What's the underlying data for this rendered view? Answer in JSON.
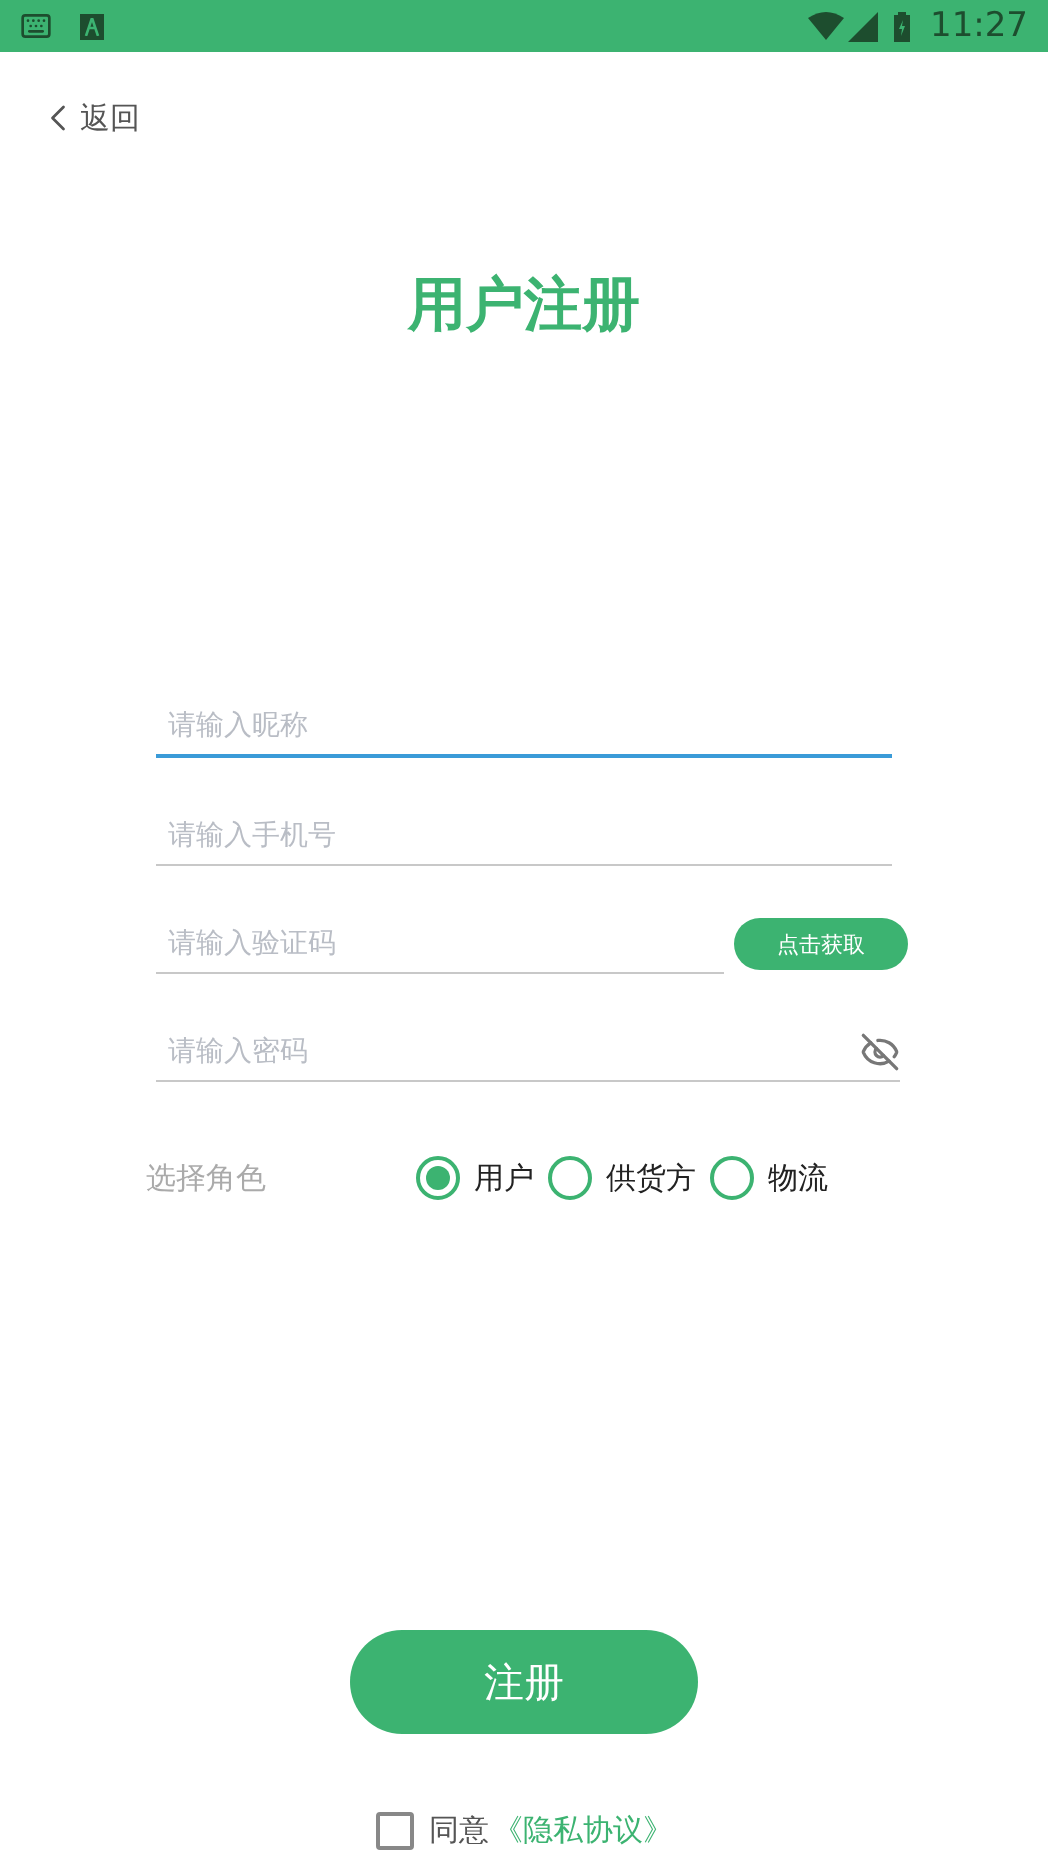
{
  "status_bar": {
    "time": "11:27"
  },
  "back": {
    "label": "返回"
  },
  "title": "用户注册",
  "fields": [
    {
      "kind": "text",
      "placeholder": "请输入昵称",
      "focused": true
    },
    {
      "kind": "text",
      "placeholder": "请输入手机号",
      "focused": false
    },
    {
      "kind": "code",
      "placeholder": "请输入验证码",
      "focused": false,
      "button": "点击获取"
    },
    {
      "kind": "password",
      "placeholder": "请输入密码",
      "focused": false
    }
  ],
  "role": {
    "label": "选择角色",
    "options": [
      {
        "label": "用户",
        "selected": true
      },
      {
        "label": "供货方",
        "selected": false
      },
      {
        "label": "物流",
        "selected": false
      }
    ]
  },
  "submit": "注册",
  "agreement": {
    "checked": false,
    "text": "同意",
    "link": "《隐私协议》"
  }
}
